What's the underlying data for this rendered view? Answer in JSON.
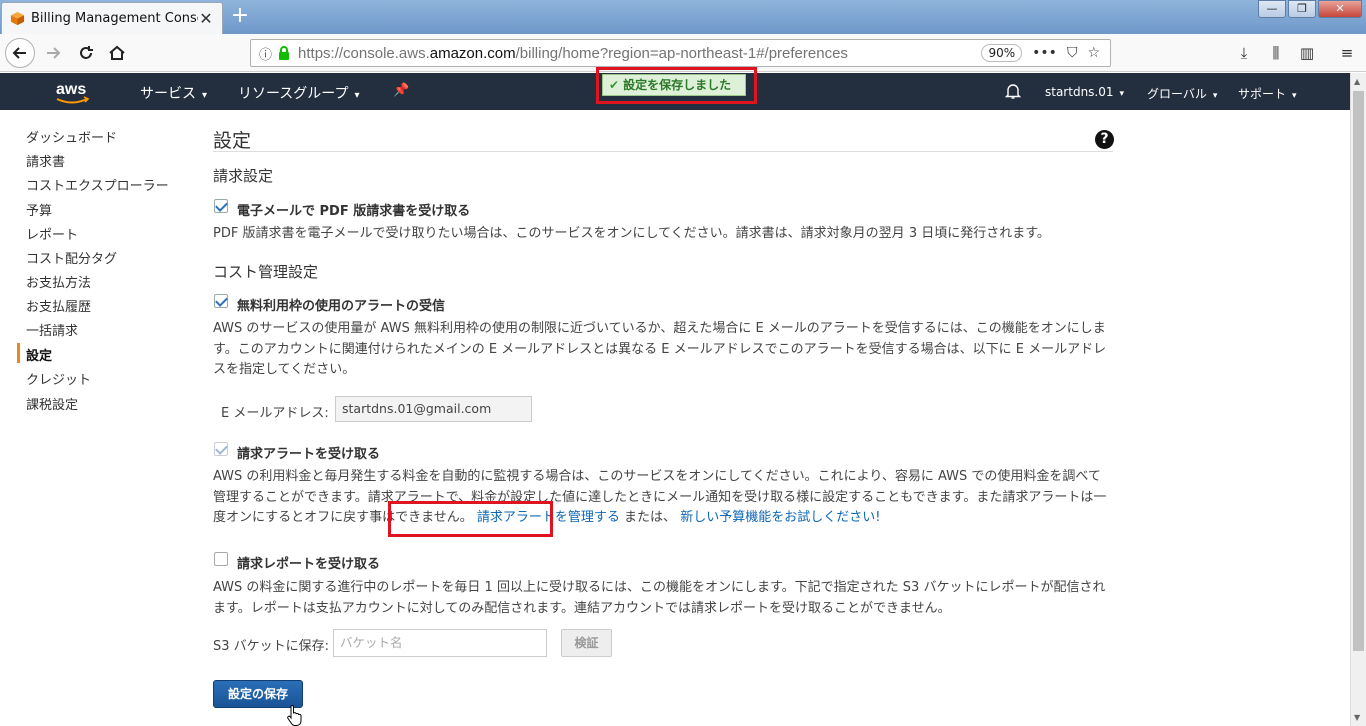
{
  "browser": {
    "tab_title": "Billing Management Console",
    "url_prefix": "https://console.aws.",
    "url_domain": "amazon.com",
    "url_path": "/billing/home?region=ap-northeast-1#/preferences",
    "zoom": "90%"
  },
  "aws_header": {
    "services": "サービス",
    "resource_groups": "リソースグループ",
    "account": "startdns.01",
    "region": "グローバル",
    "support": "サポート",
    "flash": "設定を保存しました"
  },
  "sidebar": {
    "items": [
      "ダッシュボード",
      "請求書",
      "コストエクスプローラー",
      "予算",
      "レポート",
      "コスト配分タグ",
      "お支払方法",
      "お支払履歴",
      "一括請求",
      "設定",
      "クレジット",
      "課税設定"
    ],
    "active": "設定"
  },
  "main": {
    "title": "設定",
    "billing_section": "請求設定",
    "pdf_invoice_label": "電子メールで PDF 版請求書を受け取る",
    "pdf_invoice_desc": "PDF 版請求書を電子メールで受け取りたい場合は、このサービスをオンにしてください。請求書は、請求対象月の翌月 3 日頃に発行されます。",
    "cost_section": "コスト管理設定",
    "free_tier_label": "無料利用枠の使用のアラートの受信",
    "free_tier_desc": "AWS のサービスの使用量が AWS 無料利用枠の使用の制限に近づいているか、超えた場合に E メールのアラートを受信するには、この機能をオンにします。このアカウントに関連付けられたメインの E メールアドレスとは異なる E メールアドレスでこのアラートを受信する場合は、以下に E メールアドレスを指定してください。",
    "email_label": "E メールアドレス:",
    "email_value": "startdns.01@gmail.com",
    "billing_alert_label": "請求アラートを受け取る",
    "billing_alert_desc": "AWS の利用料金と毎月発生する料金を自動的に監視する場合は、このサービスをオンにしてください。これにより、容易に AWS での使用料金を調べて管理することができます。請求アラートで、料金が設定した値に達したときにメール通知を受け取る様に設定することもできます。また請求アラートは一度オンにするとオフに戻す事はできません。",
    "manage_alerts_link": "請求アラートを管理する",
    "or_text": "または、",
    "budget_link": "新しい予算機能をお試しください!",
    "billing_report_label": "請求レポートを受け取る",
    "billing_report_desc": "AWS の料金に関する進行中のレポートを毎日 1 回以上に受け取るには、この機能をオンにします。下記で指定された S3 バケットにレポートが配信されます。レポートは支払アカウントに対してのみ配信されます。連結アカウントでは請求レポートを受け取ることができません。",
    "s3_label": "S3 バケットに保存:",
    "s3_placeholder": "バケット名",
    "verify_button": "検証",
    "save_button": "設定の保存"
  },
  "colors": {
    "aws_nav": "#232f3e",
    "accent": "#e7881c",
    "highlight": "#e0141e",
    "primary_button": "#1a5596"
  }
}
